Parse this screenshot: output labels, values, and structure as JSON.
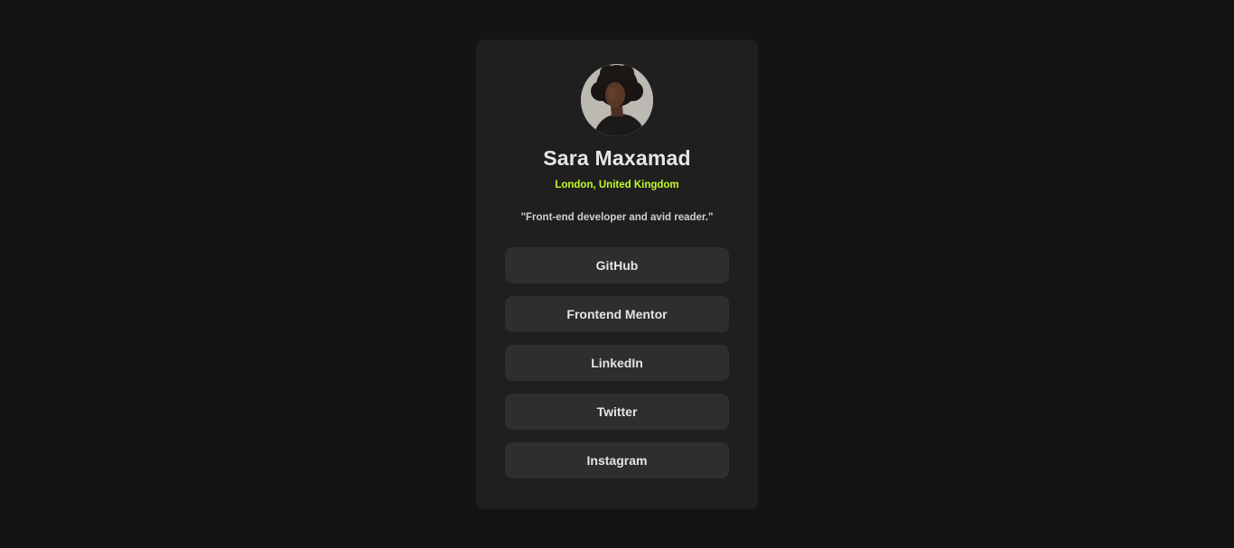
{
  "profile": {
    "name": "Sara Maxamad",
    "location": "London, United Kingdom",
    "bio": "\"Front-end developer and avid reader.\"",
    "avatar_icon": "profile-photo"
  },
  "links": [
    {
      "label": "GitHub"
    },
    {
      "label": "Frontend Mentor"
    },
    {
      "label": "LinkedIn"
    },
    {
      "label": "Twitter"
    },
    {
      "label": "Instagram"
    }
  ],
  "colors": {
    "page_background": "#141414",
    "card_background": "#1f1f1f",
    "link_background": "#2e2e2e",
    "accent": "#c4f82a",
    "text": "#e6e6e6"
  }
}
